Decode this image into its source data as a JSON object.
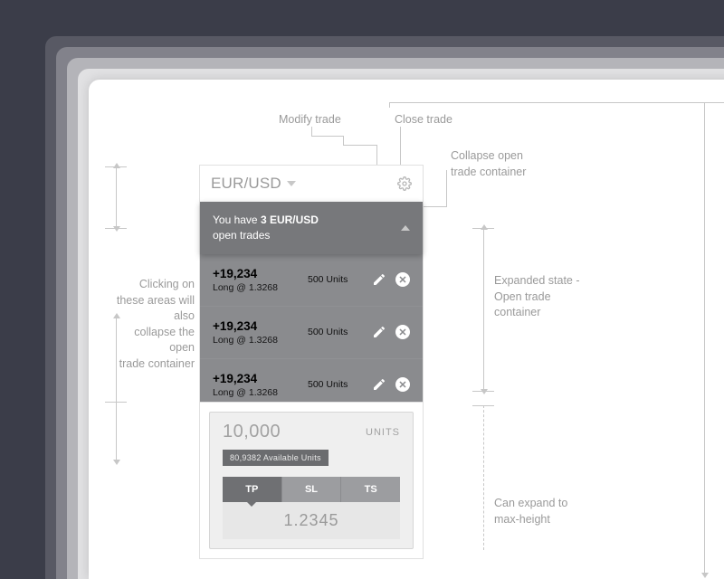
{
  "annotations": {
    "modify": "Modify trade",
    "close": "Close trade",
    "collapse": "Collapse open\ntrade container",
    "clickAreas": "Clicking on\nthese areas will also\ncollapse the open\ntrade container",
    "expanded": "Expanded state -\nOpen trade\ncontainer",
    "maxHeight": "Can expand to\nmax-height"
  },
  "header": {
    "pair": "EUR/USD"
  },
  "info": {
    "prefix": "You have ",
    "bold": "3 EUR/USD",
    "suffix": "open trades"
  },
  "trades": [
    {
      "pnl": "+19,234",
      "side": "Long @ 1.3268",
      "units": "500 Units"
    },
    {
      "pnl": "+19,234",
      "side": "Long @ 1.3268",
      "units": "500 Units"
    },
    {
      "pnl": "+19,234",
      "side": "Long @ 1.3268",
      "units": "500 Units"
    }
  ],
  "order": {
    "amount": "10,000",
    "unitsLabel": "UNITS",
    "available": "80,9382 Available Units",
    "tabs": {
      "tp": "TP",
      "sl": "SL",
      "ts": "TS"
    },
    "price": "1.2345"
  }
}
